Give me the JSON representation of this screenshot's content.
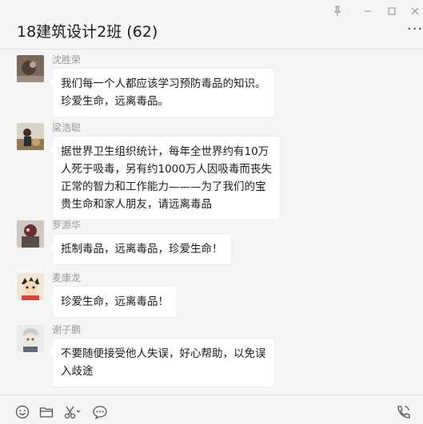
{
  "window": {
    "title": "18建筑设计2班 (62)"
  },
  "messages": [
    {
      "sender": "沈胜荣",
      "lines": [
        "我们每一个人都应该学习预防毒品的知识。",
        "珍爱生命，远离毒品。"
      ]
    },
    {
      "sender": "梁浩聪",
      "lines": [
        "据世界卫生组织统计，每年全世界约有10万",
        "人死于吸毒，另有约1000万人因吸毒而丧失",
        "正常的智力和工作能力———为了我们的宝",
        "贵生命和家人朋友，请远离毒品"
      ]
    },
    {
      "sender": "罗源华",
      "lines": [
        "抵制毒品，远离毒品，珍爱生命！"
      ]
    },
    {
      "sender": "麦康龙",
      "lines": [
        "珍爱生命，远离毒品！"
      ]
    },
    {
      "sender": "谢子鹏",
      "lines": [
        "不要随便接受他人失误，好心帮助，以免误",
        "入歧途"
      ]
    }
  ],
  "toolbar": {
    "icons": [
      "emoji-icon",
      "folder-icon",
      "scissors-icon",
      "chat-history-icon",
      "voice-call-icon"
    ]
  },
  "colors": {
    "background": "#f5f5f5",
    "bubble": "#ffffff",
    "sender": "#999999"
  }
}
